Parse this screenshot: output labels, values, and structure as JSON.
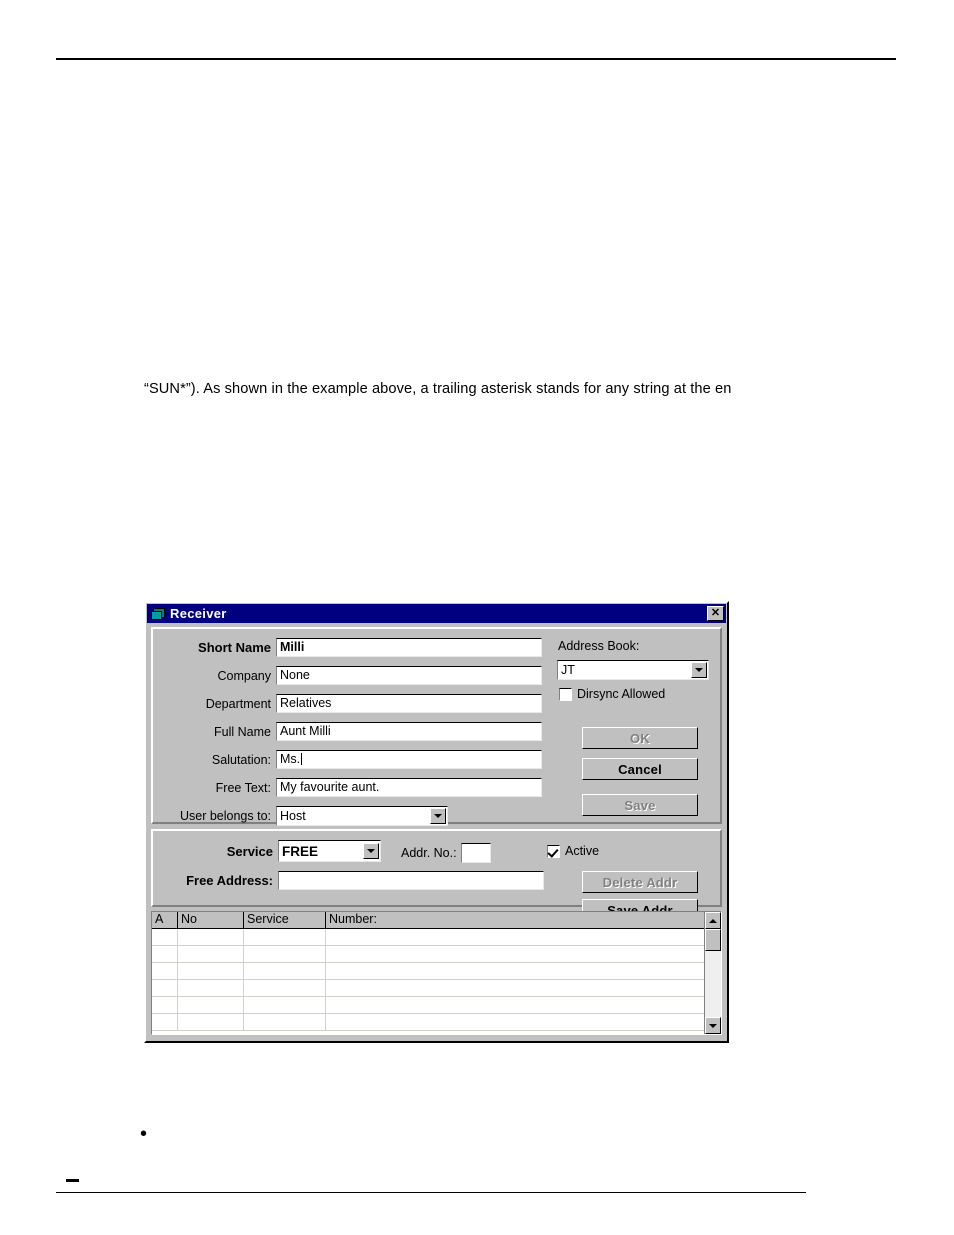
{
  "document": {
    "paragraph": "“SUN*”). As shown in the example above, a trailing asterisk stands for any string at the en",
    "bullet_glyph": "•"
  },
  "dialog": {
    "title": "Receiver",
    "close_label": "✕",
    "fields": [
      {
        "label": "Short Name",
        "value": "Milli",
        "bold": true
      },
      {
        "label": "Company",
        "value": "None",
        "bold": false
      },
      {
        "label": "Department",
        "value": "Relatives",
        "bold": false
      },
      {
        "label": "Full Name",
        "value": "Aunt Milli",
        "bold": false
      },
      {
        "label": "Salutation:",
        "value": "Ms.",
        "bold": false
      },
      {
        "label": "Free Text:",
        "value": "My favourite aunt.",
        "bold": false
      }
    ],
    "user_belongs_to": {
      "label": "User belongs to:",
      "value": "Host"
    },
    "address_book": {
      "label": "Address Book:",
      "value": "JT"
    },
    "dirsync": {
      "label": "Dirsync Allowed",
      "checked": false
    },
    "buttons": {
      "ok": "OK",
      "cancel": "Cancel",
      "save": "Save",
      "delete_addr": "Delete Addr",
      "save_addr": "Save Addr"
    },
    "service_section": {
      "service_label": "Service",
      "service_value": "FREE",
      "addr_no_label": "Addr. No.:",
      "addr_no_value": "",
      "active_label": "Active",
      "active_checked": true,
      "free_address_label": "Free Address:",
      "free_address_value": ""
    },
    "grid": {
      "columns": [
        "A",
        "No",
        "Service",
        "Number:"
      ],
      "rows": [
        [
          "",
          "",
          "",
          ""
        ],
        [
          "",
          "",
          "",
          ""
        ],
        [
          "",
          "",
          "",
          ""
        ],
        [
          "",
          "",
          "",
          ""
        ],
        [
          "",
          "",
          "",
          ""
        ],
        [
          "",
          "",
          "",
          ""
        ]
      ]
    }
  },
  "colors": {
    "titlebar": "#000080",
    "face": "#c0c0c0",
    "shadow": "#808080",
    "field": "#ffffff"
  }
}
